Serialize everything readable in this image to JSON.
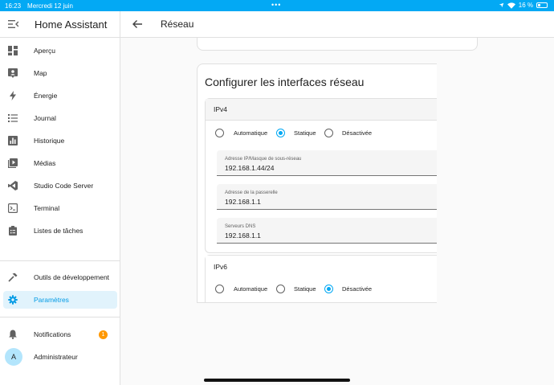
{
  "status": {
    "time": "16:23",
    "date": "Mercredi 12 juin",
    "battery": "16 %"
  },
  "app": {
    "title": "Home Assistant"
  },
  "nav": {
    "items": [
      {
        "label": "Aperçu",
        "icon": "dashboard-icon"
      },
      {
        "label": "Map",
        "icon": "map-icon"
      },
      {
        "label": "Énergie",
        "icon": "lightning-icon"
      },
      {
        "label": "Journal",
        "icon": "list-icon"
      },
      {
        "label": "Historique",
        "icon": "chart-icon"
      },
      {
        "label": "Médias",
        "icon": "media-icon"
      },
      {
        "label": "Studio Code Server",
        "icon": "vscode-icon"
      },
      {
        "label": "Terminal",
        "icon": "terminal-icon"
      },
      {
        "label": "Listes de tâches",
        "icon": "clipboard-icon"
      }
    ],
    "dev_tools": "Outils de développement",
    "settings": "Paramètres",
    "notifications": "Notifications",
    "notifications_count": "1",
    "user": "Administrateur",
    "user_initial": "A"
  },
  "page": {
    "title": "Réseau"
  },
  "card": {
    "title": "Configurer les interfaces réseau",
    "ipv4": {
      "label": "IPv4",
      "options": [
        "Automatique",
        "Statique",
        "Désactivée"
      ],
      "selected": "Statique",
      "fields": [
        {
          "label": "Adresse IP/Masque de sous-réseau",
          "value": "192.168.1.44/24"
        },
        {
          "label": "Adresse de la passerelle",
          "value": "192.168.1.1"
        },
        {
          "label": "Serveurs DNS",
          "value": "192.168.1.1"
        }
      ]
    },
    "ipv6": {
      "label": "IPv6",
      "options": [
        "Automatique",
        "Statique",
        "Désactivée"
      ],
      "selected": "Désactivée"
    }
  },
  "colors": {
    "accent": "#03a9f4",
    "active_bg": "#e1f3fc",
    "badge": "#ff9800"
  }
}
